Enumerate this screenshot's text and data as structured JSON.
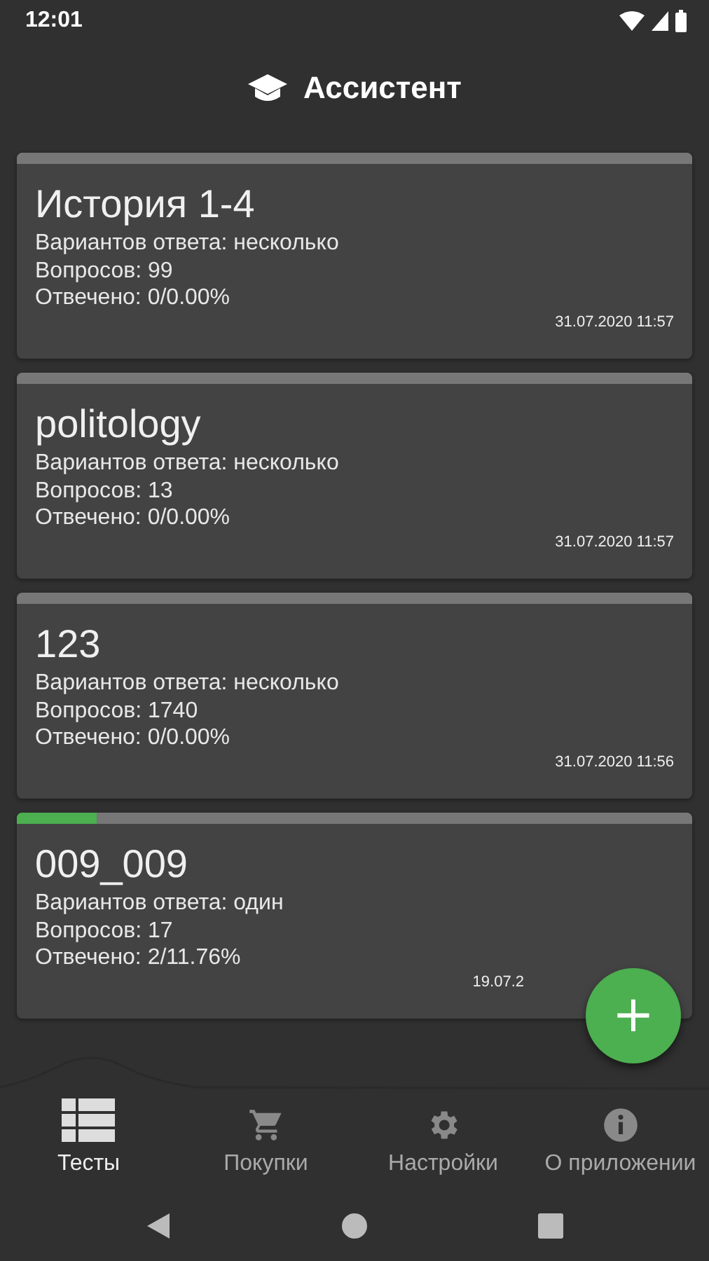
{
  "status_bar": {
    "time": "12:01"
  },
  "app_bar": {
    "title": "Ассистент"
  },
  "tests": [
    {
      "title": "История 1-4",
      "options": "Вариантов ответа: несколько",
      "questions": "Вопросов: 99",
      "answered": "Отвечено: 0/0.00%",
      "date": "31.07.2020 11:57",
      "level": 0
    },
    {
      "title": "politology",
      "options": "Вариантов ответа: несколько",
      "questions": "Вопросов: 13",
      "answered": "Отвечено: 0/0.00%",
      "date": "31.07.2020 11:57",
      "level": 0
    },
    {
      "title": "123",
      "options": "Вариантов ответа: несколько",
      "questions": "Вопросов: 1740",
      "answered": "Отвечено: 0/0.00%",
      "date": "31.07.2020 11:56",
      "level": 0
    },
    {
      "title": "009_009",
      "options": "Вариантов ответа: один",
      "questions": "Вопросов: 17",
      "answered": "Отвечено: 2/11.76%",
      "date": "19.07.2",
      "level": 0.1176
    }
  ],
  "fab": {
    "label": "+"
  },
  "bottom_nav": [
    {
      "kind": "list",
      "label": "Тесты",
      "selected": true
    },
    {
      "kind": "cart",
      "label": "Покупки",
      "selected": false
    },
    {
      "kind": "gear",
      "label": "Настройки",
      "selected": false
    },
    {
      "kind": "info",
      "label": "О приложении",
      "selected": false
    }
  ]
}
